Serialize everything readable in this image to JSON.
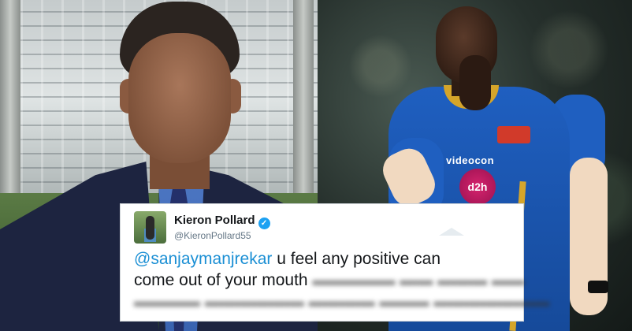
{
  "tweet": {
    "display_name": "Kieron Pollard",
    "handle": "@KieronPollard55",
    "verified": true,
    "mention": "@sanjaymanjrekar",
    "text_line1_rest": " u feel any positive can",
    "text_line2": "come out of your mouth"
  },
  "jersey": {
    "sponsor": "videocon",
    "badge": "d2h"
  },
  "colors": {
    "mention": "#1b8fd4",
    "verified": "#1da1f2",
    "jersey_blue": "#1f5fc0"
  },
  "icons": [
    "verified-badge-icon"
  ]
}
